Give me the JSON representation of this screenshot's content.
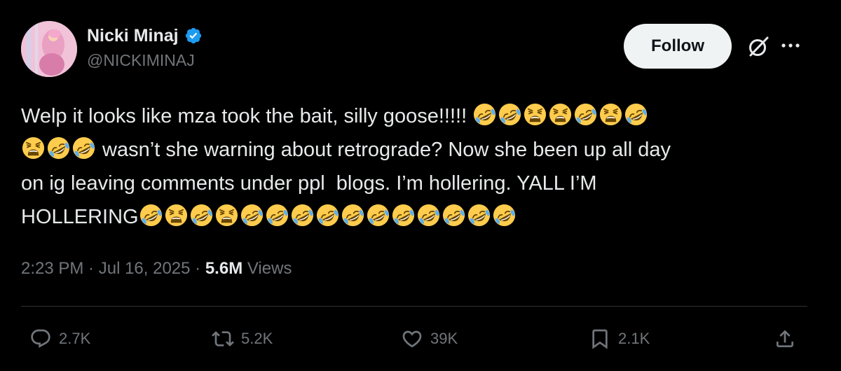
{
  "author": {
    "display_name": "Nicki Minaj",
    "handle": "@NICKIMINAJ"
  },
  "header": {
    "follow_label": "Follow"
  },
  "tweet": {
    "lines": [
      [
        {
          "t": "text",
          "v": "Welp it looks like mza took the bait, silly goose!!!!! "
        },
        {
          "t": "emoji",
          "v": "rofl"
        },
        {
          "t": "emoji",
          "v": "rofl"
        },
        {
          "t": "emoji",
          "v": "weary"
        },
        {
          "t": "emoji",
          "v": "weary"
        },
        {
          "t": "emoji",
          "v": "rofl"
        },
        {
          "t": "emoji",
          "v": "weary"
        },
        {
          "t": "emoji",
          "v": "rofl"
        }
      ],
      [
        {
          "t": "emoji",
          "v": "weary"
        },
        {
          "t": "emoji",
          "v": "rofl"
        },
        {
          "t": "emoji",
          "v": "rofl"
        },
        {
          "t": "text",
          "v": " wasn’t she warning about retrograde? Now she been up all day"
        }
      ],
      [
        {
          "t": "text",
          "v": "on ig leaving comments under ppl  blogs. I’m hollering. YALL I’M"
        }
      ],
      [
        {
          "t": "text",
          "v": "HOLLERING"
        },
        {
          "t": "emoji",
          "v": "rofl"
        },
        {
          "t": "emoji",
          "v": "weary"
        },
        {
          "t": "emoji",
          "v": "rofl"
        },
        {
          "t": "emoji",
          "v": "weary"
        },
        {
          "t": "emoji",
          "v": "rofl"
        },
        {
          "t": "emoji",
          "v": "rofl"
        },
        {
          "t": "emoji",
          "v": "rofl"
        },
        {
          "t": "emoji",
          "v": "rofl"
        },
        {
          "t": "emoji",
          "v": "rofl"
        },
        {
          "t": "emoji",
          "v": "rofl"
        },
        {
          "t": "emoji",
          "v": "rofl"
        },
        {
          "t": "emoji",
          "v": "rofl"
        },
        {
          "t": "emoji",
          "v": "rofl"
        },
        {
          "t": "emoji",
          "v": "rofl"
        },
        {
          "t": "emoji",
          "v": "rofl"
        }
      ]
    ]
  },
  "meta": {
    "time": "2:23 PM",
    "separator": " · ",
    "date": "Jul 16, 2025",
    "views_count": "5.6M",
    "views_label": " Views"
  },
  "actions": {
    "replies": "2.7K",
    "reposts": "5.2K",
    "likes": "39K",
    "bookmarks": "2.1K"
  },
  "icons": {
    "verified": "verified-badge-icon",
    "grok": "grok-icon",
    "more": "more-icon",
    "reply": "reply-icon",
    "repost": "repost-icon",
    "like": "heart-icon",
    "bookmark": "bookmark-icon",
    "share": "share-icon",
    "emoji_rofl": "rolling-on-floor-laughing-emoji",
    "emoji_weary": "weary-face-emoji"
  },
  "colors": {
    "background": "#000000",
    "text": "#e7e9ea",
    "secondary": "#71767b",
    "verified": "#1d9bf0",
    "follow_bg": "#eff3f4",
    "divider": "#2f3336"
  }
}
